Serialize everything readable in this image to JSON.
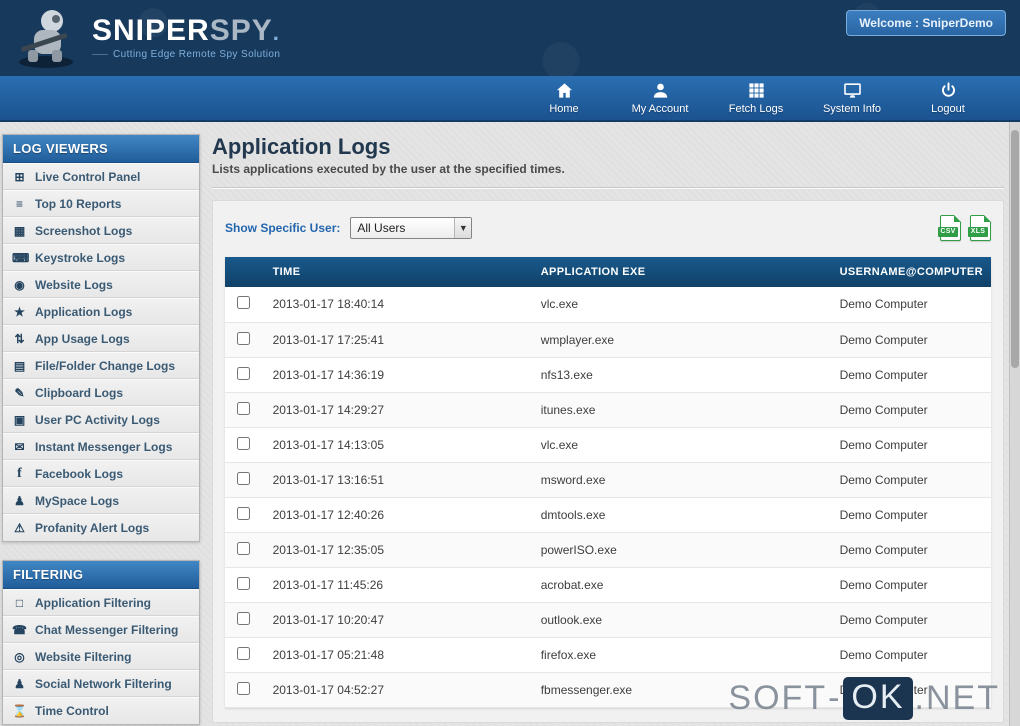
{
  "header": {
    "brand_primary": "SNIPER",
    "brand_secondary": "SPY",
    "brand_dot": ".",
    "tagline": "Cutting Edge Remote Spy Solution",
    "welcome_label": "Welcome : SniperDemo"
  },
  "nav": {
    "items": [
      {
        "label": "Home",
        "icon": "home-icon"
      },
      {
        "label": "My Account",
        "icon": "user-icon"
      },
      {
        "label": "Fetch Logs",
        "icon": "fetch-logs-icon"
      },
      {
        "label": "System Info",
        "icon": "system-info-icon"
      },
      {
        "label": "Logout",
        "icon": "logout-icon"
      }
    ]
  },
  "sidebar": {
    "sections": [
      {
        "title": "LOG VIEWERS",
        "items": [
          {
            "label": "Live Control Panel",
            "icon": "live-control-panel-icon"
          },
          {
            "label": "Top 10 Reports",
            "icon": "top10-reports-icon"
          },
          {
            "label": "Screenshot Logs",
            "icon": "screenshot-logs-icon"
          },
          {
            "label": "Keystroke Logs",
            "icon": "keystroke-logs-icon"
          },
          {
            "label": "Website Logs",
            "icon": "website-logs-icon"
          },
          {
            "label": "Application Logs",
            "icon": "application-logs-icon"
          },
          {
            "label": "App Usage Logs",
            "icon": "app-usage-logs-icon"
          },
          {
            "label": "File/Folder Change Logs",
            "icon": "file-folder-change-logs-icon"
          },
          {
            "label": "Clipboard Logs",
            "icon": "clipboard-logs-icon"
          },
          {
            "label": "User PC Activity Logs",
            "icon": "user-pc-activity-logs-icon"
          },
          {
            "label": "Instant Messenger Logs",
            "icon": "instant-messenger-logs-icon"
          },
          {
            "label": "Facebook Logs",
            "icon": "facebook-logs-icon"
          },
          {
            "label": "MySpace Logs",
            "icon": "myspace-logs-icon"
          },
          {
            "label": "Profanity Alert Logs",
            "icon": "profanity-alert-logs-icon"
          }
        ]
      },
      {
        "title": "FILTERING",
        "items": [
          {
            "label": "Application Filtering",
            "icon": "application-filtering-icon"
          },
          {
            "label": "Chat Messenger Filtering",
            "icon": "chat-messenger-filtering-icon"
          },
          {
            "label": "Website Filtering",
            "icon": "website-filtering-icon"
          },
          {
            "label": "Social Network Filtering",
            "icon": "social-network-filtering-icon"
          },
          {
            "label": "Time Control",
            "icon": "time-control-icon"
          }
        ]
      }
    ]
  },
  "main": {
    "title": "Application Logs",
    "subtitle": "Lists applications executed by the user at the specified times.",
    "filter_label": "Show Specific User:",
    "user_select_value": "All Users",
    "export": {
      "csv_label": "CSV",
      "xls_label": "XLS"
    },
    "table": {
      "columns": [
        "TIME",
        "APPLICATION EXE",
        "USERNAME@COMPUTER"
      ],
      "rows": [
        {
          "time": "2013-01-17 18:40:14",
          "application": "vlc.exe",
          "user": "Demo Computer"
        },
        {
          "time": "2013-01-17 17:25:41",
          "application": "wmplayer.exe",
          "user": "Demo Computer"
        },
        {
          "time": "2013-01-17 14:36:19",
          "application": "nfs13.exe",
          "user": "Demo Computer"
        },
        {
          "time": "2013-01-17 14:29:27",
          "application": "itunes.exe",
          "user": "Demo Computer"
        },
        {
          "time": "2013-01-17 14:13:05",
          "application": "vlc.exe",
          "user": "Demo Computer"
        },
        {
          "time": "2013-01-17 13:16:51",
          "application": "msword.exe",
          "user": "Demo Computer"
        },
        {
          "time": "2013-01-17 12:40:26",
          "application": "dmtools.exe",
          "user": "Demo Computer"
        },
        {
          "time": "2013-01-17 12:35:05",
          "application": "powerISO.exe",
          "user": "Demo Computer"
        },
        {
          "time": "2013-01-17 11:45:26",
          "application": "acrobat.exe",
          "user": "Demo Computer"
        },
        {
          "time": "2013-01-17 10:20:47",
          "application": "outlook.exe",
          "user": "Demo Computer"
        },
        {
          "time": "2013-01-17 05:21:48",
          "application": "firefox.exe",
          "user": "Demo Computer"
        },
        {
          "time": "2013-01-17 04:52:27",
          "application": "fbmessenger.exe",
          "user": "Demo Computer"
        }
      ]
    }
  },
  "watermark": {
    "part1": "SOFT",
    "separator": "-",
    "part2": "OK",
    "part3": ".NET"
  },
  "colors": {
    "header_navy": "#17395c",
    "nav_blue": "#2a6fb2",
    "accent_blue": "#2366ae",
    "table_header_blue": "#0f4168",
    "export_green": "#2f9e47"
  }
}
